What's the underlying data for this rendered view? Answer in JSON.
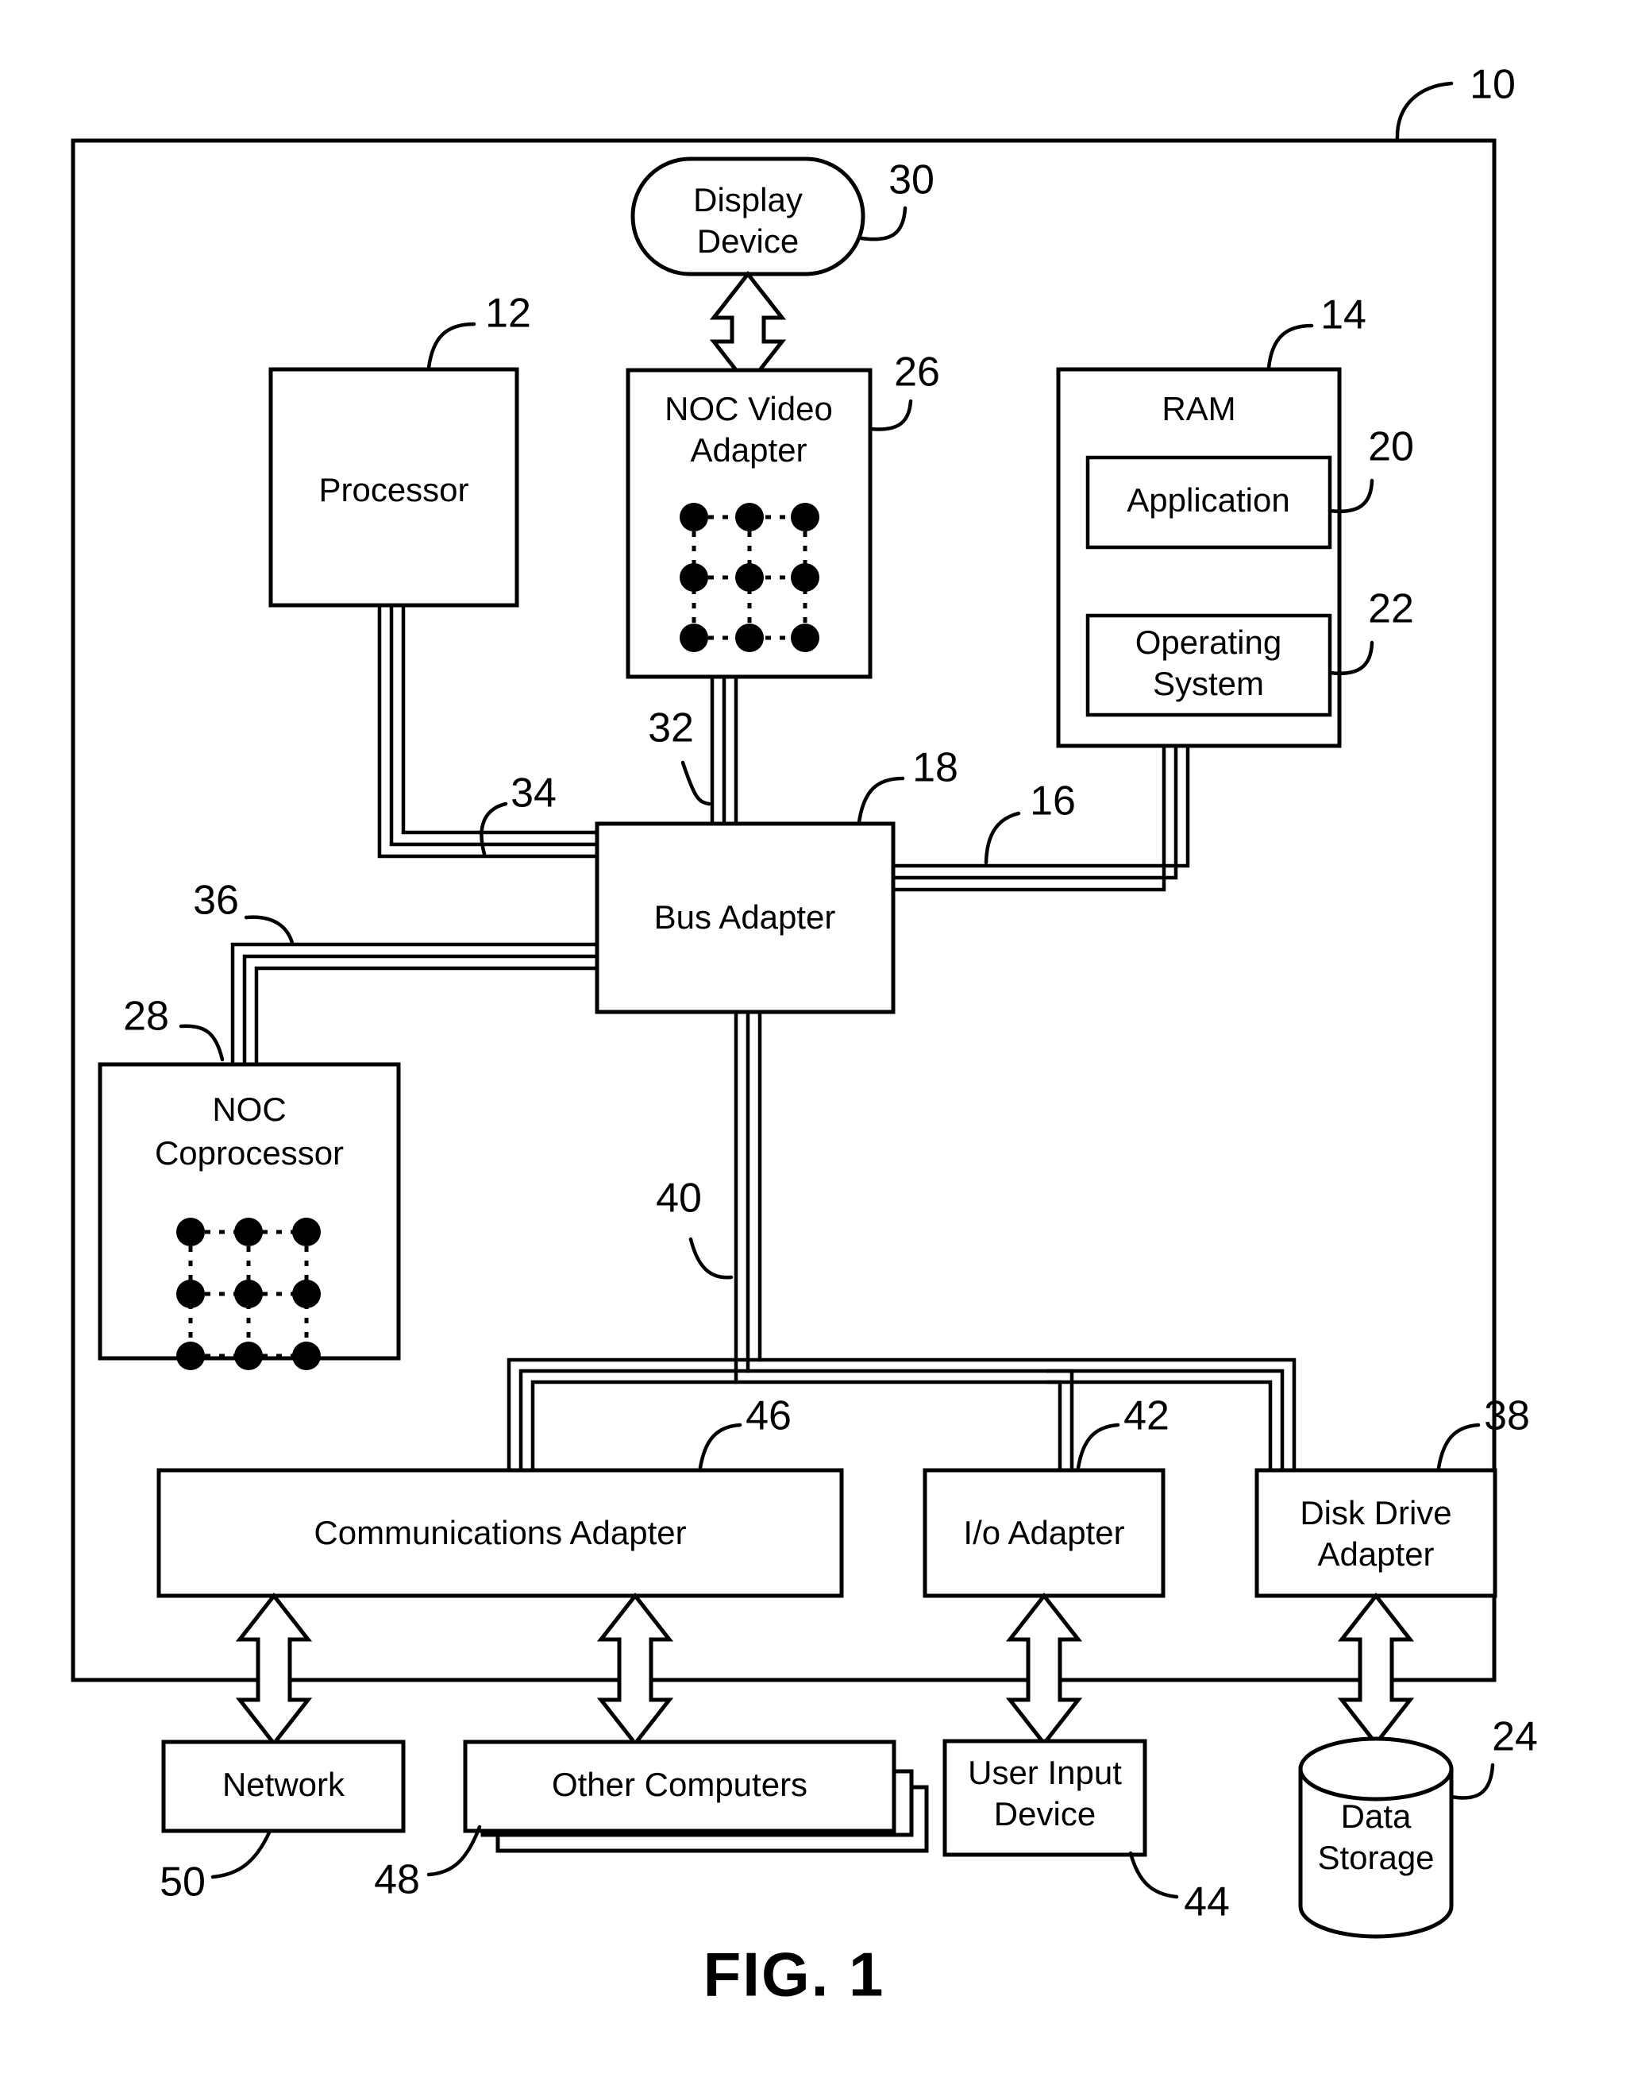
{
  "figure": {
    "caption": "FIG. 1",
    "outer_ref": "10"
  },
  "blocks": {
    "display_device": {
      "label_line1": "Display",
      "label_line2": "Device",
      "ref": "30",
      "shape": "rounded-rect"
    },
    "processor": {
      "label": "Processor",
      "ref": "12",
      "shape": "rect"
    },
    "noc_video_adapter": {
      "label_line1": "NOC Video",
      "label_line2": "Adapter",
      "ref": "26",
      "shape": "rect-with-mesh"
    },
    "ram": {
      "label": "RAM",
      "ref": "14",
      "shape": "rect"
    },
    "application": {
      "label": "Application",
      "ref": "20",
      "shape": "rect"
    },
    "operating_system": {
      "label_line1": "Operating",
      "label_line2": "System",
      "ref": "22",
      "shape": "rect"
    },
    "bus_adapter": {
      "label": "Bus Adapter",
      "ref": "18",
      "shape": "rect"
    },
    "noc_coprocessor": {
      "label_line1": "NOC",
      "label_line2": "Coprocessor",
      "ref": "28",
      "shape": "rect-with-mesh"
    },
    "communications_adapter": {
      "label": "Communications Adapter",
      "ref": "46",
      "shape": "rect"
    },
    "io_adapter": {
      "label": "I/o Adapter",
      "ref": "42",
      "shape": "rect"
    },
    "disk_drive_adapter": {
      "label_line1": "Disk Drive",
      "label_line2": "Adapter",
      "ref": "38",
      "shape": "rect"
    },
    "network": {
      "label": "Network",
      "ref": "50",
      "shape": "rect"
    },
    "other_computers": {
      "label": "Other Computers",
      "ref": "48",
      "shape": "stacked-rect"
    },
    "user_input_device": {
      "label_line1": "User Input",
      "label_line2": "Device",
      "ref": "44",
      "shape": "rect"
    },
    "data_storage": {
      "label_line1": "Data",
      "label_line2": "Storage",
      "ref": "24",
      "shape": "cylinder"
    }
  },
  "buses": {
    "video_bus": {
      "ref": "32"
    },
    "front_side_bus": {
      "ref": "34"
    },
    "coprocessor_bus": {
      "ref": "36"
    },
    "memory_bus": {
      "ref": "16"
    },
    "expansion_bus": {
      "ref": "40"
    }
  },
  "colors": {
    "line": "#000000",
    "fill": "#ffffff"
  }
}
